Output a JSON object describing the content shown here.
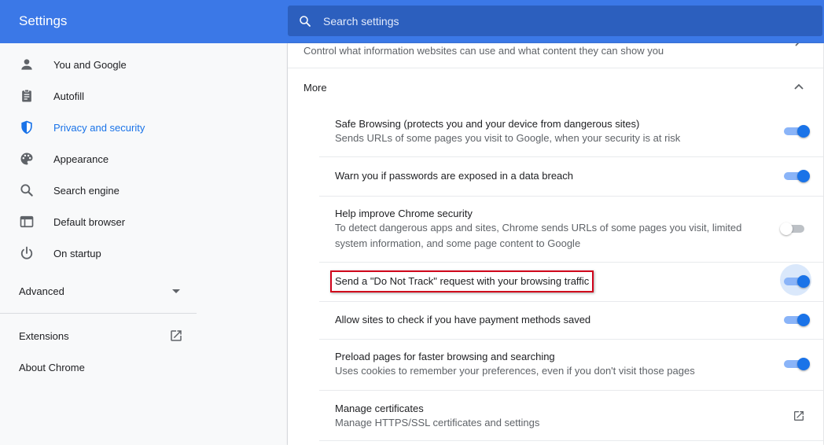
{
  "header": {
    "title": "Settings"
  },
  "search": {
    "placeholder": "Search settings"
  },
  "sidebar": {
    "items": [
      {
        "label": "You and Google",
        "icon": "person-icon"
      },
      {
        "label": "Autofill",
        "icon": "clipboard-icon"
      },
      {
        "label": "Privacy and security",
        "icon": "shield-icon",
        "active": true
      },
      {
        "label": "Appearance",
        "icon": "palette-icon"
      },
      {
        "label": "Search engine",
        "icon": "search-icon"
      },
      {
        "label": "Default browser",
        "icon": "browser-window-icon"
      },
      {
        "label": "On startup",
        "icon": "power-icon"
      }
    ],
    "advanced_label": "Advanced",
    "extensions_label": "Extensions",
    "about_label": "About Chrome"
  },
  "main": {
    "top_description": "Control what information websites can use and what content they can show you",
    "more_label": "More",
    "settings": [
      {
        "title": "Safe Browsing (protects you and your device from dangerous sites)",
        "subtitle": "Sends URLs of some pages you visit to Google, when your security is at risk",
        "enabled": true
      },
      {
        "title": "Warn you if passwords are exposed in a data breach",
        "subtitle": "",
        "enabled": true
      },
      {
        "title": "Help improve Chrome security",
        "subtitle": "To detect dangerous apps and sites, Chrome sends URLs of some pages you visit, limited system information, and some page content to Google",
        "enabled": false
      },
      {
        "title": "Send a \"Do Not Track\" request with your browsing traffic",
        "subtitle": "",
        "enabled": true
      },
      {
        "title": "Allow sites to check if you have payment methods saved",
        "subtitle": "",
        "enabled": true
      },
      {
        "title": "Preload pages for faster browsing and searching",
        "subtitle": "Uses cookies to remember your preferences, even if you don't visit those pages",
        "enabled": true
      }
    ],
    "manage_certificates": {
      "title": "Manage certificates",
      "subtitle": "Manage HTTPS/SSL certificates and settings"
    }
  },
  "colors": {
    "header": "#3b78e7",
    "accent": "#1a73e8",
    "highlight_border": "#d0021b"
  }
}
